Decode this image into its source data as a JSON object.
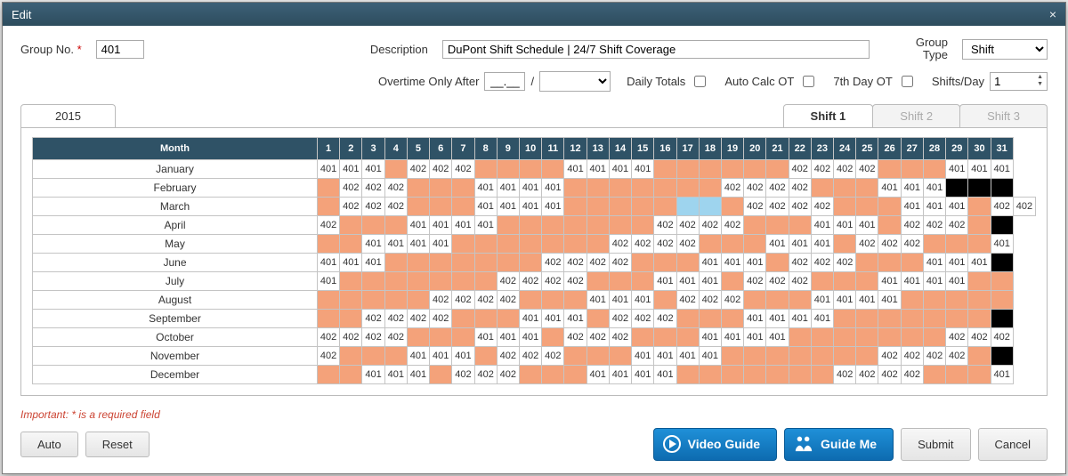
{
  "dialog": {
    "title": "Edit",
    "close": "×"
  },
  "form": {
    "group_no_label": "Group No.",
    "group_no_value": "401",
    "desc_label": "Description",
    "desc_value": "DuPont Shift Schedule | 24/7 Shift Coverage",
    "group_type_label": "Group Type",
    "group_type_value": "Shift",
    "ot_after_label": "Overtime Only After",
    "ot_after_value": "__.__",
    "ot_slash": "/",
    "ot_unit_value": "",
    "daily_totals_label": "Daily Totals",
    "auto_calc_label": "Auto Calc OT",
    "seventh_day_label": "7th Day OT",
    "shifts_day_label": "Shifts/Day",
    "shifts_day_value": "1"
  },
  "tabs": {
    "year": "2015",
    "shift1": "Shift 1",
    "shift2": "Shift 2",
    "shift3": "Shift 3"
  },
  "grid": {
    "month_header": "Month",
    "day_numbers": [
      "1",
      "2",
      "3",
      "4",
      "5",
      "6",
      "7",
      "8",
      "9",
      "10",
      "11",
      "12",
      "13",
      "14",
      "15",
      "16",
      "17",
      "18",
      "19",
      "20",
      "21",
      "22",
      "23",
      "24",
      "25",
      "26",
      "27",
      "28",
      "29",
      "30",
      "31"
    ],
    "months": [
      {
        "n": "January",
        "cells": [
          "401",
          "401",
          "401",
          "o",
          "402",
          "402",
          "402",
          "o",
          "o",
          "o",
          "o",
          "401",
          "401",
          "401",
          "401",
          "o",
          "o",
          "o",
          "o",
          "o",
          "o",
          "402",
          "402",
          "402",
          "402",
          "o",
          "o",
          "o",
          "401",
          "401",
          "401"
        ]
      },
      {
        "n": "February",
        "cells": [
          "o",
          "402",
          "402",
          "402",
          "o",
          "o",
          "o",
          "401",
          "401",
          "401",
          "401",
          "o",
          "o",
          "o",
          "o",
          "o",
          "o",
          "o",
          "402",
          "402",
          "402",
          "402",
          "o",
          "o",
          "o",
          "401",
          "401",
          "401",
          "b",
          "b",
          "b"
        ]
      },
      {
        "n": "March",
        "cells": [
          "o",
          "402",
          "402",
          "402",
          "o",
          "o",
          "o",
          "401",
          "401",
          "401",
          "401",
          "o",
          "o",
          "o",
          "o",
          "o",
          "u",
          "u",
          "o",
          "402",
          "402",
          "402",
          "402",
          "o",
          "o",
          "o",
          "401",
          "401",
          "401",
          "o",
          "402",
          "402"
        ]
      },
      {
        "n": "April",
        "cells": [
          "402",
          "o",
          "o",
          "o",
          "401",
          "401",
          "401",
          "401",
          "o",
          "o",
          "o",
          "o",
          "o",
          "o",
          "o",
          "402",
          "402",
          "402",
          "402",
          "o",
          "o",
          "o",
          "401",
          "401",
          "401",
          "o",
          "402",
          "402",
          "402",
          "o",
          "b"
        ]
      },
      {
        "n": "May",
        "cells": [
          "o",
          "o",
          "401",
          "401",
          "401",
          "401",
          "o",
          "o",
          "o",
          "o",
          "o",
          "o",
          "o",
          "402",
          "402",
          "402",
          "402",
          "o",
          "o",
          "o",
          "401",
          "401",
          "401",
          "o",
          "402",
          "402",
          "402",
          "o",
          "o",
          "o",
          "401"
        ]
      },
      {
        "n": "June",
        "cells": [
          "401",
          "401",
          "401",
          "o",
          "o",
          "o",
          "o",
          "o",
          "o",
          "o",
          "402",
          "402",
          "402",
          "402",
          "o",
          "o",
          "o",
          "401",
          "401",
          "401",
          "o",
          "402",
          "402",
          "402",
          "o",
          "o",
          "o",
          "401",
          "401",
          "401",
          "b"
        ]
      },
      {
        "n": "July",
        "cells": [
          "401",
          "o",
          "o",
          "o",
          "o",
          "o",
          "o",
          "o",
          "402",
          "402",
          "402",
          "402",
          "o",
          "o",
          "o",
          "401",
          "401",
          "401",
          "o",
          "402",
          "402",
          "402",
          "o",
          "o",
          "o",
          "401",
          "401",
          "401",
          "401",
          "o",
          "o"
        ]
      },
      {
        "n": "August",
        "cells": [
          "o",
          "o",
          "o",
          "o",
          "o",
          "402",
          "402",
          "402",
          "402",
          "o",
          "o",
          "o",
          "401",
          "401",
          "401",
          "o",
          "402",
          "402",
          "402",
          "o",
          "o",
          "o",
          "401",
          "401",
          "401",
          "401",
          "o",
          "o",
          "o",
          "o",
          "o"
        ]
      },
      {
        "n": "September",
        "cells": [
          "o",
          "o",
          "402",
          "402",
          "402",
          "402",
          "o",
          "o",
          "o",
          "401",
          "401",
          "401",
          "o",
          "402",
          "402",
          "402",
          "o",
          "o",
          "o",
          "401",
          "401",
          "401",
          "401",
          "o",
          "o",
          "o",
          "o",
          "o",
          "o",
          "o",
          "b"
        ]
      },
      {
        "n": "October",
        "cells": [
          "402",
          "402",
          "402",
          "402",
          "o",
          "o",
          "o",
          "401",
          "401",
          "401",
          "o",
          "402",
          "402",
          "402",
          "o",
          "o",
          "o",
          "401",
          "401",
          "401",
          "401",
          "o",
          "o",
          "o",
          "o",
          "o",
          "o",
          "o",
          "402",
          "402",
          "402"
        ]
      },
      {
        "n": "November",
        "cells": [
          "402",
          "o",
          "o",
          "o",
          "401",
          "401",
          "401",
          "o",
          "402",
          "402",
          "402",
          "o",
          "o",
          "o",
          "401",
          "401",
          "401",
          "401",
          "o",
          "o",
          "o",
          "o",
          "o",
          "o",
          "o",
          "402",
          "402",
          "402",
          "402",
          "o",
          "b"
        ]
      },
      {
        "n": "December",
        "cells": [
          "o",
          "o",
          "401",
          "401",
          "401",
          "o",
          "402",
          "402",
          "402",
          "o",
          "o",
          "o",
          "401",
          "401",
          "401",
          "401",
          "o",
          "o",
          "o",
          "o",
          "o",
          "o",
          "o",
          "402",
          "402",
          "402",
          "402",
          "o",
          "o",
          "o",
          "401"
        ]
      }
    ]
  },
  "footnote": "Important: * is a required field",
  "buttons": {
    "auto": "Auto",
    "reset": "Reset",
    "video": "Video Guide",
    "guide": "Guide Me",
    "submit": "Submit",
    "cancel": "Cancel"
  }
}
